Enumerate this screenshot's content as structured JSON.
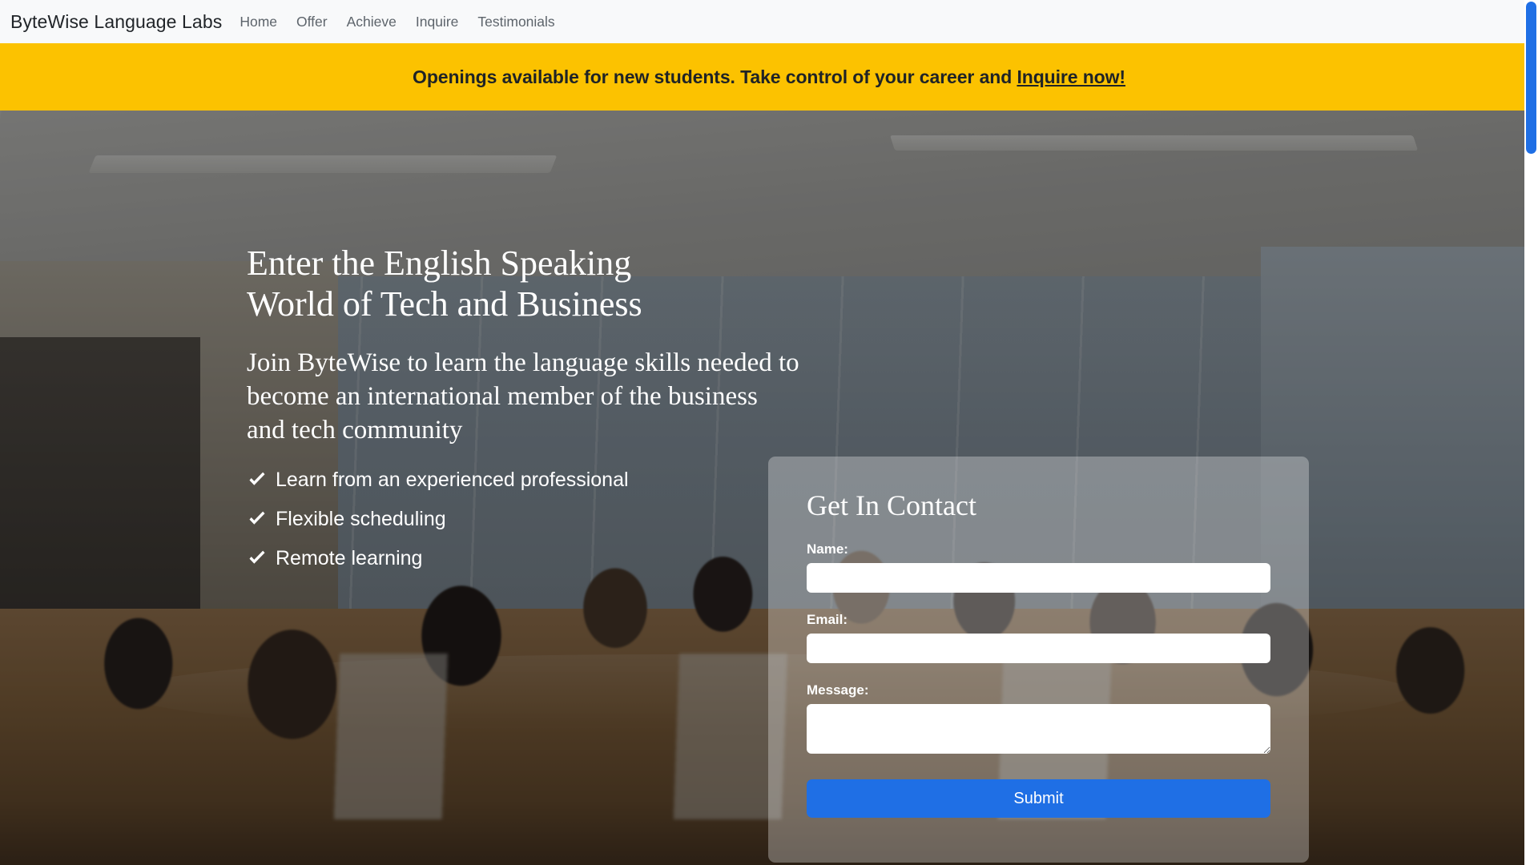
{
  "navbar": {
    "brand": "ByteWise Language Labs",
    "links": [
      {
        "label": "Home"
      },
      {
        "label": "Offer"
      },
      {
        "label": "Achieve"
      },
      {
        "label": "Inquire"
      },
      {
        "label": "Testimonials"
      }
    ]
  },
  "banner": {
    "text_before": "Openings available for new students. Take control of your career and ",
    "link_label": "Inquire now!",
    "background_color": "#fcc200",
    "text_color": "#1f2326"
  },
  "hero": {
    "title_line1": "Enter the English Speaking",
    "title_line2": "World of Tech and Business",
    "subtitle": "Join ByteWise to learn the language skills needed to become an international member of the business and tech community",
    "features": [
      {
        "icon": "check-icon",
        "label": "Learn from an experienced professional"
      },
      {
        "icon": "check-icon",
        "label": "Flexible scheduling"
      },
      {
        "icon": "check-icon",
        "label": "Remote learning"
      }
    ]
  },
  "form": {
    "title": "Get In Contact",
    "name_label": "Name:",
    "name_value": "",
    "email_label": "Email:",
    "email_value": "",
    "message_label": "Message:",
    "message_value": "",
    "submit_label": "Submit",
    "submit_color": "#1f6fe5"
  },
  "scrollbar": {
    "thumb_color": "#1f6fe5"
  }
}
